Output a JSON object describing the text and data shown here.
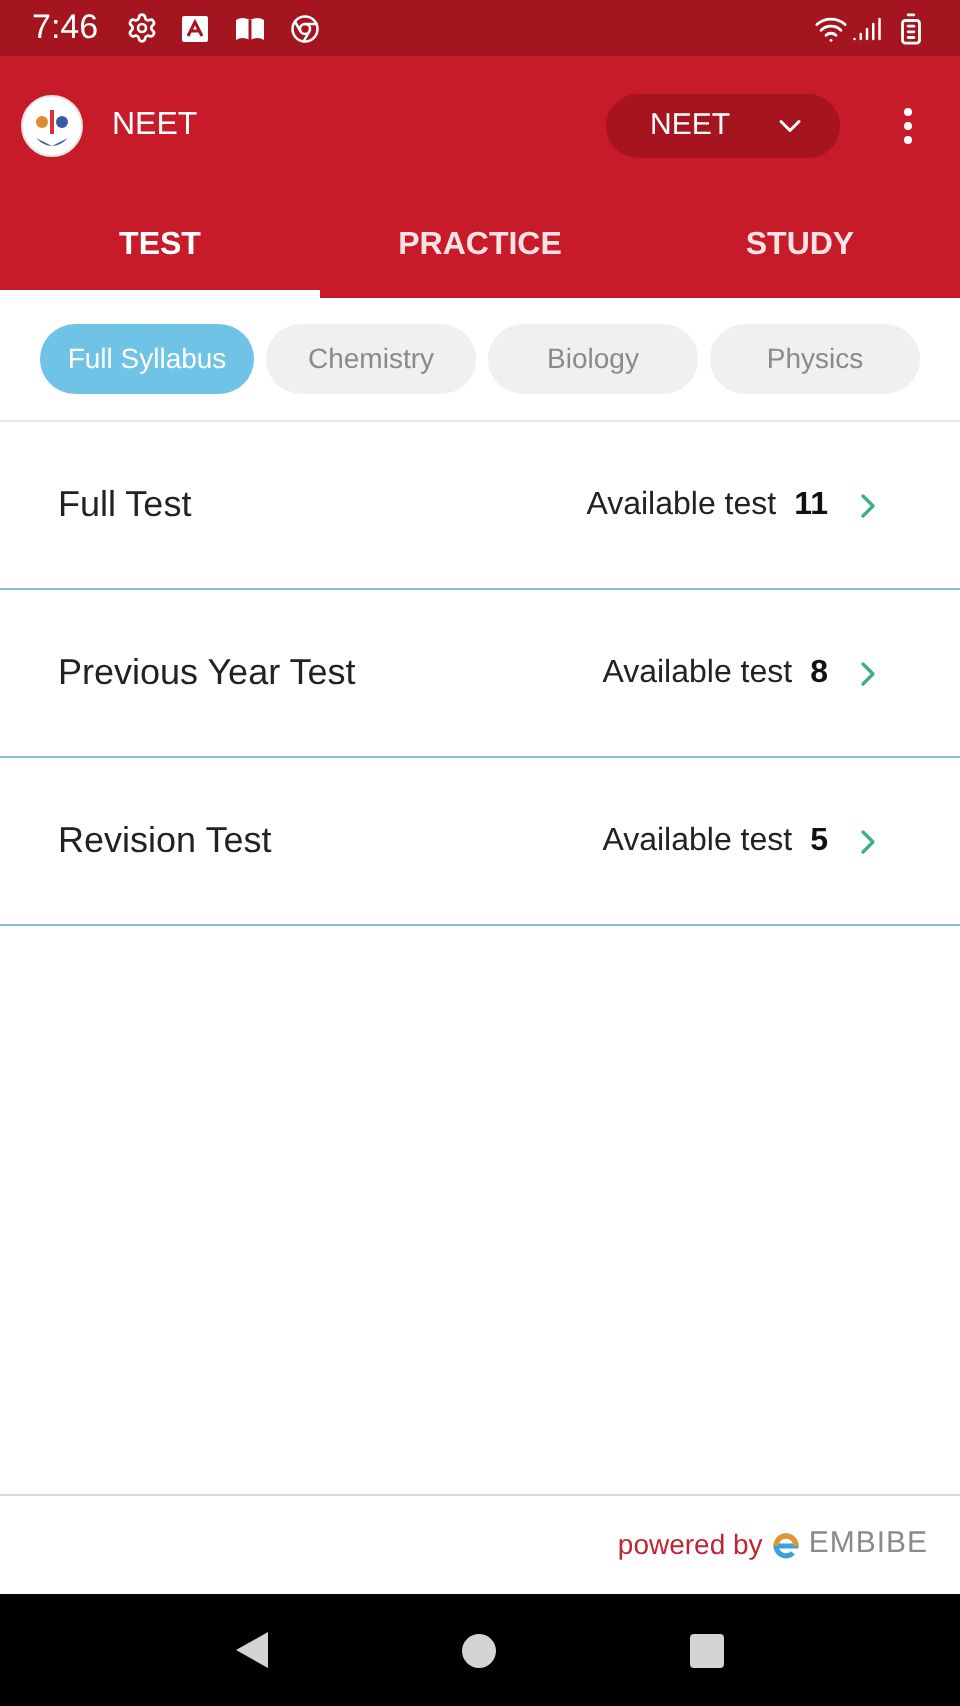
{
  "status_bar": {
    "time": "7:46"
  },
  "app_bar": {
    "title": "NEET",
    "selector": {
      "value": "NEET"
    }
  },
  "tabs": [
    {
      "label": "TEST",
      "selected": true
    },
    {
      "label": "PRACTICE",
      "selected": false
    },
    {
      "label": "STUDY",
      "selected": false
    }
  ],
  "filters": [
    {
      "label": "Full Syllabus",
      "selected": true
    },
    {
      "label": "Chemistry",
      "selected": false
    },
    {
      "label": "Biology",
      "selected": false
    },
    {
      "label": "Physics",
      "selected": false
    }
  ],
  "tests": [
    {
      "name": "Full Test",
      "available_label": "Available test",
      "count": "11"
    },
    {
      "name": "Previous Year Test",
      "available_label": "Available test",
      "count": "8"
    },
    {
      "name": "Revision Test",
      "available_label": "Available test",
      "count": "5"
    }
  ],
  "footer": {
    "powered_by": "powered by",
    "brand": "EMBIBE"
  }
}
